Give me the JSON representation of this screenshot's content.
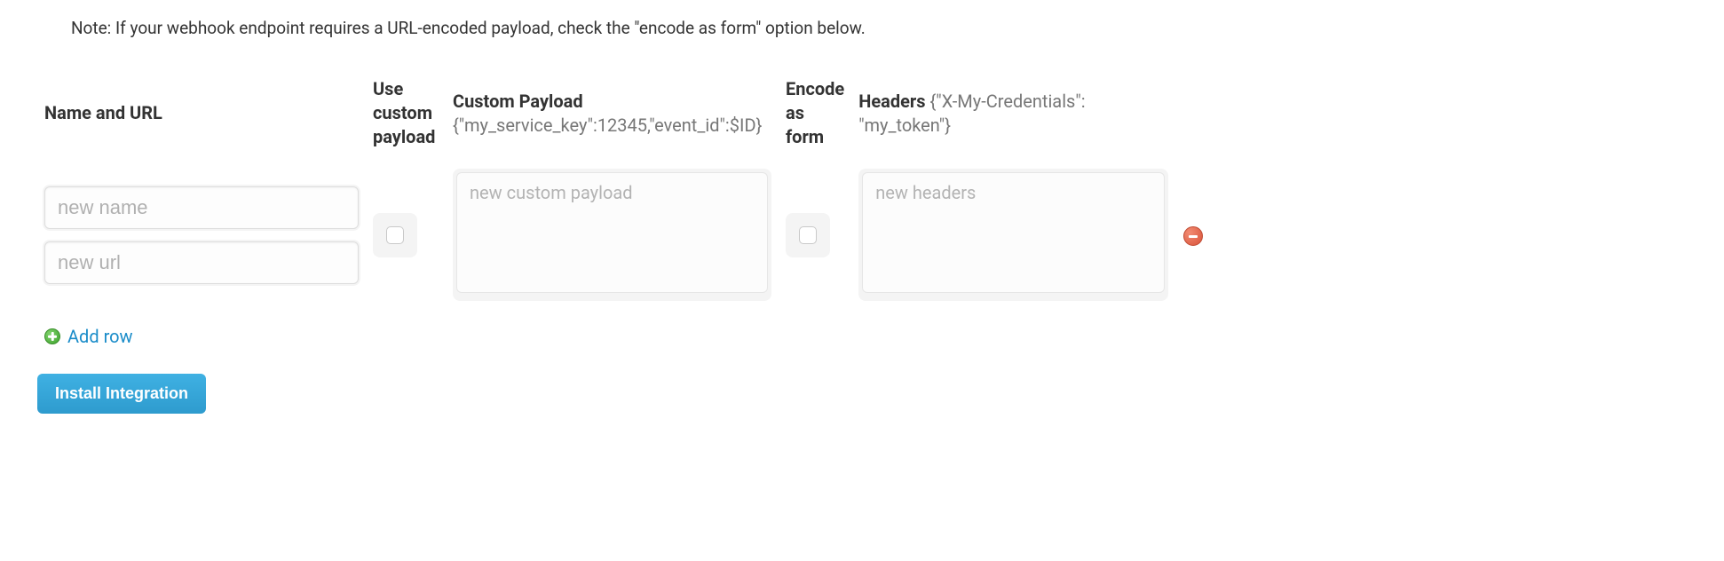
{
  "note": "Note: If your webhook endpoint requires a URL-encoded payload, check the \"encode as form\" option below.",
  "headers": {
    "name_url": "Name and URL",
    "use_custom": "Use custom payload",
    "custom_payload_label": "Custom Payload",
    "custom_payload_hint": "{\"my_service_key\":12345,\"event_id\":$ID}",
    "encode_form": "Encode as form",
    "headers_label": "Headers",
    "headers_hint": "{\"X-My-Credentials\": \"my_token\"}"
  },
  "row": {
    "name_placeholder": "new name",
    "url_placeholder": "new url",
    "payload_placeholder": "new custom payload",
    "headers_placeholder": "new headers",
    "name_value": "",
    "url_value": "",
    "payload_value": "",
    "headers_value": "",
    "use_custom_checked": false,
    "encode_form_checked": false
  },
  "actions": {
    "add_row": "Add row",
    "install": "Install Integration"
  }
}
